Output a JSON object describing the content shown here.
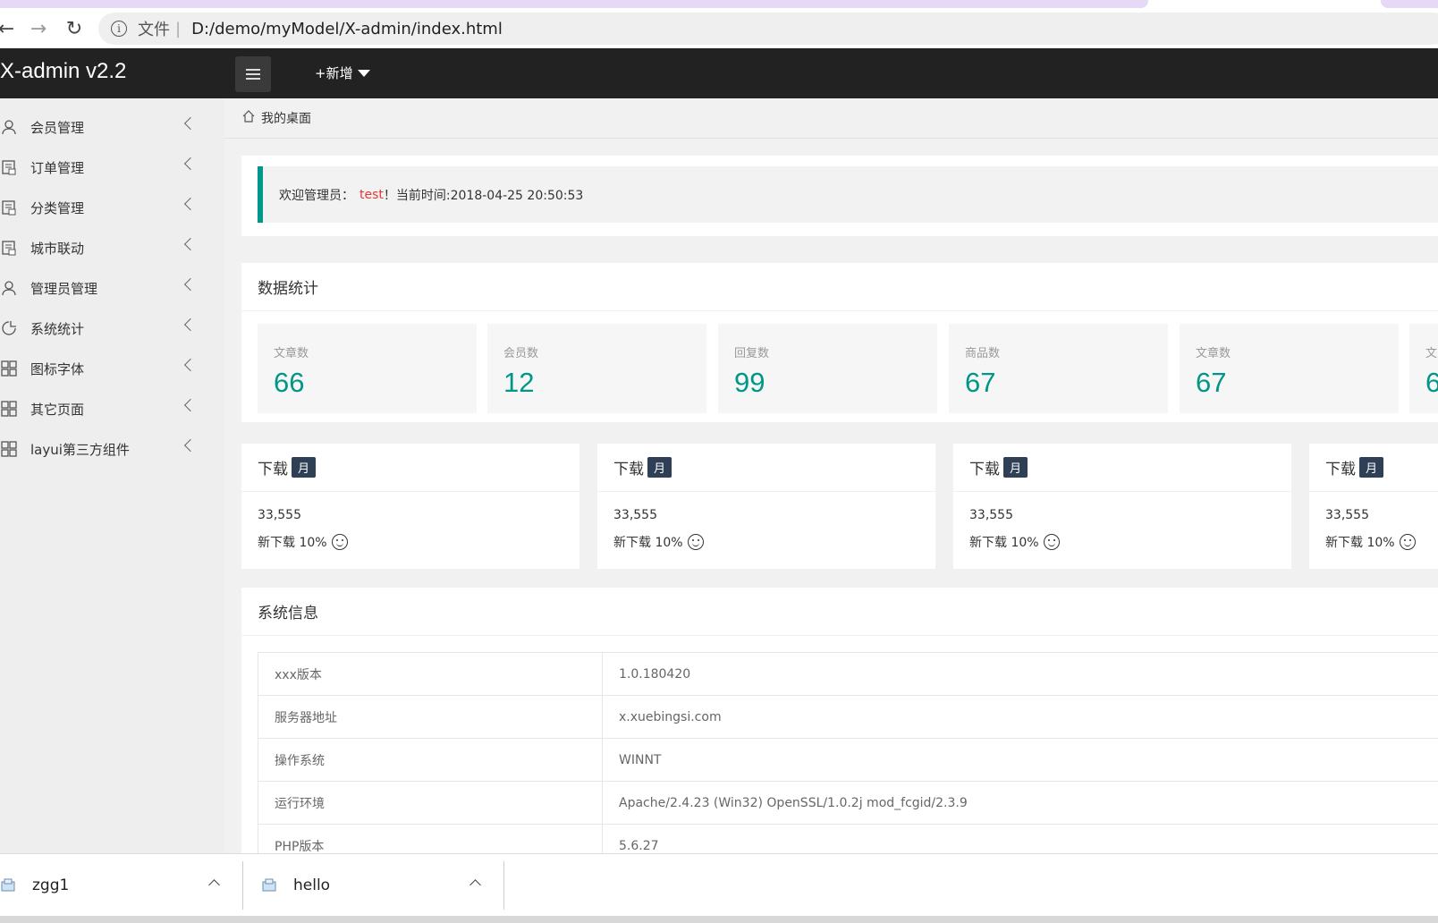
{
  "browser": {
    "url_scheme": "文件",
    "url_separator": "|",
    "url": "D:/demo/myModel/X-admin/index.html"
  },
  "header": {
    "logo": "X-admin v2.2",
    "add_menu": "+新增"
  },
  "sidebar": {
    "items": [
      {
        "label": "会员管理",
        "icon": "user-icon"
      },
      {
        "label": "订单管理",
        "icon": "order-icon"
      },
      {
        "label": "分类管理",
        "icon": "order-icon"
      },
      {
        "label": "城市联动",
        "icon": "order-icon"
      },
      {
        "label": "管理员管理",
        "icon": "user-icon"
      },
      {
        "label": "系统统计",
        "icon": "chart-icon"
      },
      {
        "label": "图标字体",
        "icon": "grid-icon"
      },
      {
        "label": "其它页面",
        "icon": "grid-icon"
      },
      {
        "label": "layui第三方组件",
        "icon": "grid-icon"
      }
    ]
  },
  "breadcrumb": {
    "label": "我的桌面"
  },
  "welcome": {
    "prefix": "欢迎管理员：",
    "user": "test",
    "suffix": "！当前时间:2018-04-25 20:50:53"
  },
  "stats": {
    "title": "数据统计",
    "items": [
      {
        "label": "文章数",
        "value": "66"
      },
      {
        "label": "会员数",
        "value": "12"
      },
      {
        "label": "回复数",
        "value": "99"
      },
      {
        "label": "商品数",
        "value": "67"
      },
      {
        "label": "文章数",
        "value": "67"
      },
      {
        "label": "文",
        "value": "6"
      }
    ]
  },
  "downloads": [
    {
      "title": "下载",
      "badge": "月",
      "count": "33,555",
      "sub": "新下载 10%"
    },
    {
      "title": "下载",
      "badge": "月",
      "count": "33,555",
      "sub": "新下载 10%"
    },
    {
      "title": "下载",
      "badge": "月",
      "count": "33,555",
      "sub": "新下载 10%"
    },
    {
      "title": "下载",
      "badge": "月",
      "count": "33,555",
      "sub": "新下载 10%"
    }
  ],
  "system": {
    "title": "系统信息",
    "rows": [
      {
        "key": "xxx版本",
        "value": "1.0.180420"
      },
      {
        "key": "服务器地址",
        "value": "x.xuebingsi.com"
      },
      {
        "key": "操作系统",
        "value": "WINNT"
      },
      {
        "key": "运行环境",
        "value": "Apache/2.4.23 (Win32) OpenSSL/1.0.2j mod_fcgid/2.3.9"
      },
      {
        "key": "PHP版本",
        "value": "5.6.27"
      }
    ]
  },
  "download_bar": {
    "items": [
      {
        "name": "zgg1"
      },
      {
        "name": "hello"
      }
    ]
  },
  "colors": {
    "accent": "#009688",
    "header_bg": "#222222",
    "badge_bg": "#2f4056",
    "user_highlight": "#e53935"
  }
}
